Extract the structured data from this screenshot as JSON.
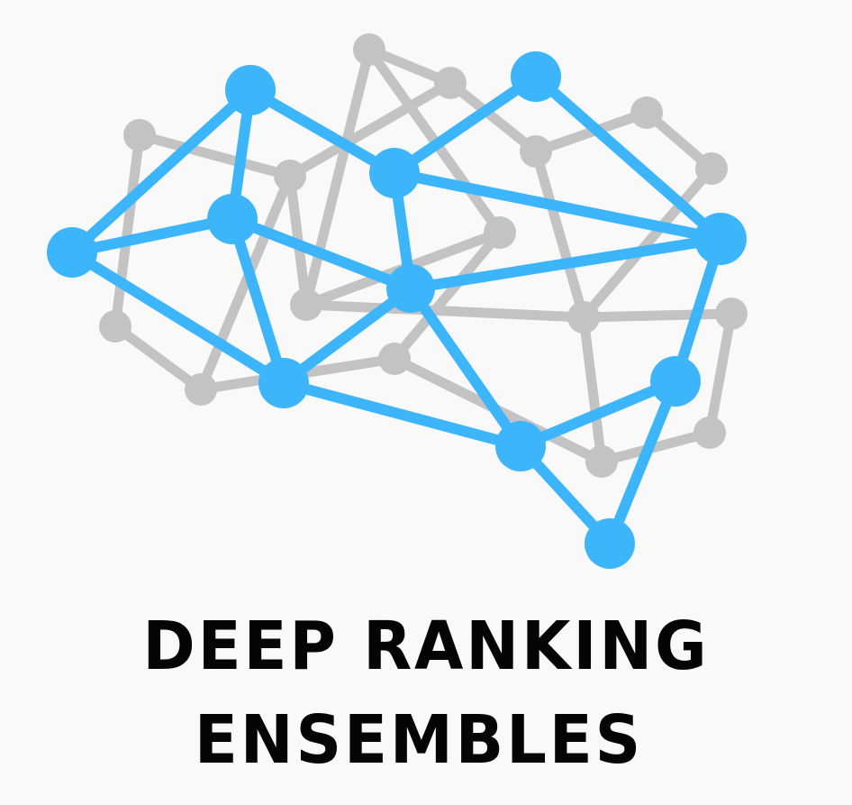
{
  "logo": {
    "title_line_1": "DEEP RANKING",
    "title_line_2": "ENSEMBLES",
    "icon": "brain-network-icon",
    "colors": {
      "background": "#f9f9f9",
      "network_accent": "#3db5fb",
      "network_muted": "#c3c3c3",
      "text": "#050505"
    }
  }
}
